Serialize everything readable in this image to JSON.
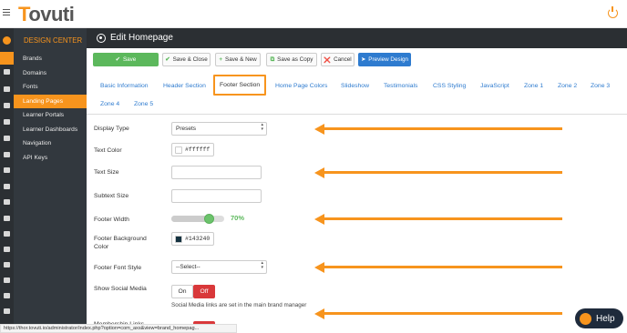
{
  "app": {
    "logo_first": "T",
    "logo_rest": "ovuti"
  },
  "design_center": {
    "heading": "DESIGN CENTER",
    "items": [
      {
        "label": "Brands"
      },
      {
        "label": "Domains"
      },
      {
        "label": "Fonts"
      },
      {
        "label": "Landing Pages",
        "active": true
      },
      {
        "label": "Learner Portals"
      },
      {
        "label": "Learner Dashboards"
      },
      {
        "label": "Navigation"
      },
      {
        "label": "API Keys"
      }
    ]
  },
  "rail_icons": [
    "avatar-icon",
    "rocket-icon",
    "chart-icon",
    "user-icon",
    "users-icon",
    "trophy-icon",
    "megaphone-icon",
    "gavel-icon",
    "star-icon",
    "grid-icon",
    "card-icon",
    "hierarchy-icon",
    "id-badge-icon",
    "cart-icon",
    "calendar-icon",
    "chat-icon",
    "document-icon",
    "book-icon"
  ],
  "page": {
    "title": "Edit Homepage"
  },
  "toolbar": {
    "save": "Save",
    "save_close": "Save & Close",
    "save_new": "Save & New",
    "save_copy": "Save as Copy",
    "cancel": "Cancel",
    "preview": "Preview Design"
  },
  "tabs": [
    {
      "label": "Basic Information"
    },
    {
      "label": "Header Section"
    },
    {
      "label": "Footer Section",
      "active": true
    },
    {
      "label": "Home Page Colors"
    },
    {
      "label": "Slideshow"
    },
    {
      "label": "Testimonials"
    },
    {
      "label": "CSS Styling"
    },
    {
      "label": "JavaScript"
    },
    {
      "label": "Zone 1"
    },
    {
      "label": "Zone 2"
    },
    {
      "label": "Zone 3"
    },
    {
      "label": "Zone 4"
    },
    {
      "label": "Zone 5"
    }
  ],
  "form": {
    "display_type": {
      "label": "Display Type",
      "value": "Presets"
    },
    "text_color": {
      "label": "Text Color",
      "value": "#ffffff",
      "swatch": "#ffffff"
    },
    "text_size": {
      "label": "Text Size",
      "value": ""
    },
    "subtext_size": {
      "label": "Subtext Size",
      "value": ""
    },
    "footer_width": {
      "label": "Footer Width",
      "value_label": "70%",
      "value": 0.7
    },
    "footer_bg": {
      "label_line1": "Footer Background",
      "label_line2": "Color",
      "value": "#143240",
      "swatch": "#143240"
    },
    "footer_font": {
      "label": "Footer Font Style",
      "value": "--Select--"
    },
    "social": {
      "label": "Show Social Media",
      "on": "On",
      "off": "Off",
      "hint": "Social Media links are set in the main brand manager"
    },
    "partial_label": "Membership Links"
  },
  "colors": {
    "accent": "#f7941d",
    "primary": "#2e7bcf",
    "success": "#5cb85c",
    "danger": "#d9383a"
  },
  "status_url": "https://thor.tovuti.io/administrator/index.php?option=com_axs&view=brand_homepag...",
  "help": {
    "label": "Help"
  }
}
